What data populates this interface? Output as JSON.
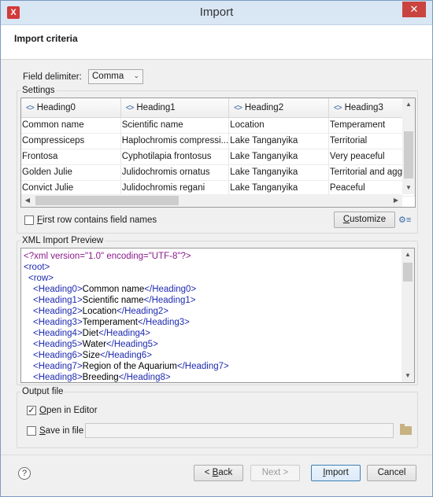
{
  "window": {
    "title": "Import",
    "close_label": "✕"
  },
  "header": {
    "title": "Import criteria"
  },
  "delimiter": {
    "label": "Field delimiter:",
    "value": "Comma"
  },
  "settings": {
    "title": "Settings",
    "columns": [
      "Heading0",
      "Heading1",
      "Heading2",
      "Heading3"
    ],
    "rows": [
      [
        "Common name",
        "Scientific name",
        "Location",
        "Temperament"
      ],
      [
        "Compressiceps",
        "Haplochromis compressi...",
        "Lake Tanganyika",
        "Territorial"
      ],
      [
        "Frontosa",
        "Cyphotilapia frontosus",
        "Lake Tanganyika",
        "Very peaceful"
      ],
      [
        "Golden Julie",
        "Julidochromis ornatus",
        "Lake Tanganyika",
        "Territorial and aggr"
      ],
      [
        "Convict Julie",
        "Julidochromis regani",
        "Lake Tanganyika",
        "Peaceful"
      ]
    ],
    "first_row_label_hot": "F",
    "first_row_label_rest": "irst row contains field names",
    "first_row_checked": false,
    "customize_hot": "C",
    "customize_rest": "ustomize"
  },
  "preview": {
    "title": "XML Import Preview",
    "declaration": "<?xml version=\"1.0\" encoding=\"UTF-8\"?>",
    "root_open": "<root>",
    "row_open": "<row>",
    "fields": [
      {
        "open": "<Heading0>",
        "text": "Common name",
        "close": "</Heading0>"
      },
      {
        "open": "<Heading1>",
        "text": "Scientific name",
        "close": "</Heading1>"
      },
      {
        "open": "<Heading2>",
        "text": "Location",
        "close": "</Heading2>"
      },
      {
        "open": "<Heading3>",
        "text": "Temperament",
        "close": "</Heading3>"
      },
      {
        "open": "<Heading4>",
        "text": "Diet",
        "close": "</Heading4>"
      },
      {
        "open": "<Heading5>",
        "text": "Water",
        "close": "</Heading5>"
      },
      {
        "open": "<Heading6>",
        "text": "Size",
        "close": "</Heading6>"
      },
      {
        "open": "<Heading7>",
        "text": "Region of the Aquarium",
        "close": "</Heading7>"
      },
      {
        "open": "<Heading8>",
        "text": "Breeding",
        "close": "</Heading8>"
      }
    ]
  },
  "output": {
    "title": "Output file",
    "open_editor_hot": "O",
    "open_editor_rest": "pen in Editor",
    "open_editor_checked": true,
    "save_file_hot": "S",
    "save_file_rest": "ave in file",
    "save_file_checked": false,
    "path_value": ""
  },
  "footer": {
    "help": "?",
    "back_prefix": "< ",
    "back_hot": "B",
    "back_rest": "ack",
    "next": "Next >",
    "import_hot": "I",
    "import_rest": "mport",
    "cancel": "Cancel"
  },
  "colors": {
    "title_bar": "#d9e6f4",
    "close_button": "#c9443f",
    "tag_blue": "#1d2ab0",
    "decl_purple": "#8a1a8a"
  },
  "icons": [
    "app-logo-icon",
    "close-icon",
    "xml-tag-icon",
    "gear-icon",
    "folder-icon",
    "help-icon"
  ]
}
